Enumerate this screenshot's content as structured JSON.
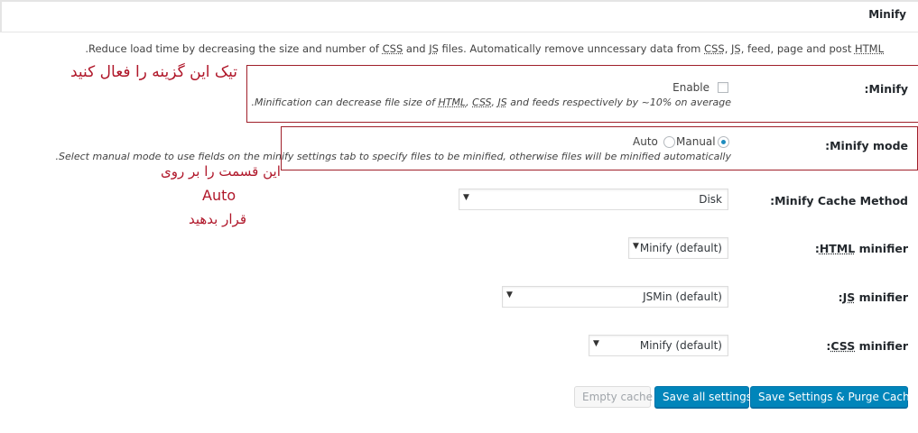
{
  "section": {
    "title": "Minify"
  },
  "description": {
    "parts": [
      "Reduce load time by decreasing the size and number of ",
      "CSS",
      " and ",
      "JS",
      " files. Automatically remove unncessary data from ",
      "CSS",
      ", ",
      "JS",
      ", feed, page and post ",
      "HTML",
      "."
    ]
  },
  "minify": {
    "label": "Minify:",
    "enable_label": "Enable",
    "enable_checked": false,
    "note_parts": [
      "Minification can decrease file size of ",
      "HTML",
      ", ",
      "CSS",
      ", ",
      "JS",
      " and feeds respectively by ~10% on average."
    ]
  },
  "minify_mode": {
    "label": "Minify mode:",
    "option_auto": "Auto",
    "option_manual": "Manual",
    "selected": "Manual",
    "note": "Select manual mode to use fields on the minify settings tab to specify files to be minified, otherwise files will be minified automatically."
  },
  "cache_method": {
    "label": "Minify Cache Method:",
    "value": "Disk"
  },
  "html_minifier": {
    "label_abbr": "HTML",
    "label_rest": " minifier:",
    "value": "Minify (default)"
  },
  "js_minifier": {
    "label_abbr": "JS",
    "label_rest": " minifier:",
    "value": "JSMin (default)"
  },
  "css_minifier": {
    "label_abbr": "CSS",
    "label_rest": " minifier:",
    "value": "Minify (default)"
  },
  "annotations": {
    "enable_hint": "تیک این گزینه را فعال کنید",
    "mode_hint_line1": "این قسمت را بر روی",
    "mode_hint_line2": "Auto",
    "mode_hint_line3": "قرار بدهید"
  },
  "buttons": {
    "empty_cache": "Empty cache",
    "save_all": "Save all settings",
    "save_purge": "Save Settings & Purge Caches"
  },
  "colors": {
    "annotation_red": "#b0172a",
    "primary_blue": "#0085ba"
  }
}
